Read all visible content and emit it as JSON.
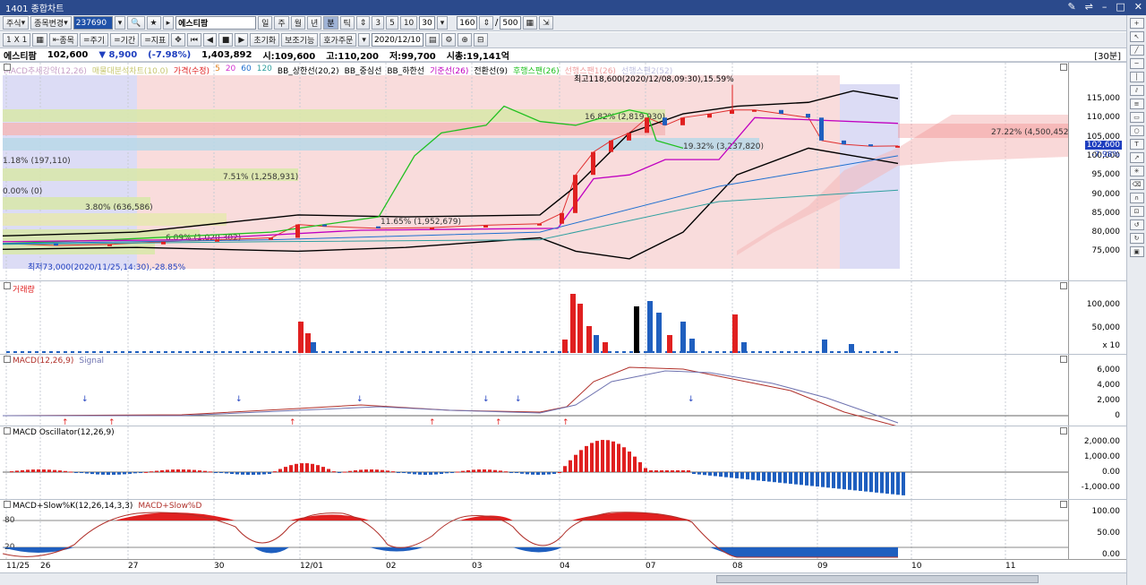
{
  "window": {
    "title": "1401 종합차트"
  },
  "toolbar1": {
    "market": "주식",
    "change_stock": "종목변경",
    "code": "237690",
    "name": "에스티팜",
    "periods": [
      "일",
      "주",
      "월",
      "년",
      "분",
      "틱"
    ],
    "active_period": "분",
    "minute_units": [
      "3",
      "5",
      "10",
      "30"
    ],
    "bars": "160",
    "total": "500"
  },
  "toolbar2": {
    "layout": "1 X 1",
    "item_btn": "종목",
    "period_btn": "주기",
    "term_btn": "기간",
    "index_btn": "지표",
    "reset": "초기화",
    "aux": "보조기능",
    "order": "호가주문",
    "date": "2020/12/10"
  },
  "info": {
    "name": "에스티팜",
    "price": "102,600",
    "change": "▼ 8,900",
    "pct": "(-7.98%)",
    "volume": "1,403,892",
    "high": "고:110,200",
    "open": "시:109,600",
    "low": "저:99,700",
    "marketcap": "시총:19,141억",
    "period_tag": "[30분]"
  },
  "main_legend": [
    "MACD추세강약(12,26)",
    "매물대분석차트(10.0)",
    "가격(수정)",
    "5",
    "20",
    "60",
    "120",
    "BB_상한선(20,2)",
    "BB_중심선",
    "BB_하한선",
    "기준선(26)",
    "전환선(9)",
    "후행스팬(26)",
    "선행스팬1(26)",
    "선행스팬2(52)"
  ],
  "annotations": {
    "high_note": "최고118,600(2020/12/08,09:30),15.59%",
    "low_note": "최저73,000(2020/11/25,14:30),-28.85%",
    "cloud_note": "27.22% (4,500,452)",
    "vp": [
      "16.82% (2,819,930)",
      "19.32% (3,237,820)",
      "1.18% (197,110)",
      "7.51% (1,258,931)",
      "0.00% (0)",
      "3.80% (636,586)",
      "6.09% (1,020,302)",
      "11.65% (1,952,679)"
    ],
    "price_tag": "102,600",
    "pct_tag": "-7.98%"
  },
  "price_axis": [
    "115,000",
    "110,000",
    "105,000",
    "100,000",
    "95,000",
    "90,000",
    "85,000",
    "80,000",
    "75,000"
  ],
  "volume": {
    "label": "거래량",
    "axis": [
      "100,000",
      "50,000",
      "x 10"
    ]
  },
  "macd": {
    "label1": "MACD(12,26,9)",
    "label2": "Signal",
    "axis": [
      "6,000",
      "4,000",
      "2,000",
      "0"
    ]
  },
  "osc": {
    "label": "MACD Oscillator(12,26,9)",
    "axis": [
      "2,000.00",
      "1,000.00",
      "0.00",
      "-1,000.00"
    ]
  },
  "stoch": {
    "label1": "MACD+Slow%K(12,26,14,3,3)",
    "label2": "MACD+Slow%D",
    "axis": [
      "100.00",
      "50.00",
      "0.00"
    ],
    "levels": [
      "80",
      "20"
    ]
  },
  "dates": [
    "11/25",
    "26",
    "27",
    "30",
    "12/01",
    "02",
    "03",
    "04",
    "07",
    "08",
    "09",
    "10",
    "11"
  ],
  "colors": {
    "up": "#e02020",
    "down": "#1f5fbf",
    "accent": "#2b4a8c"
  }
}
